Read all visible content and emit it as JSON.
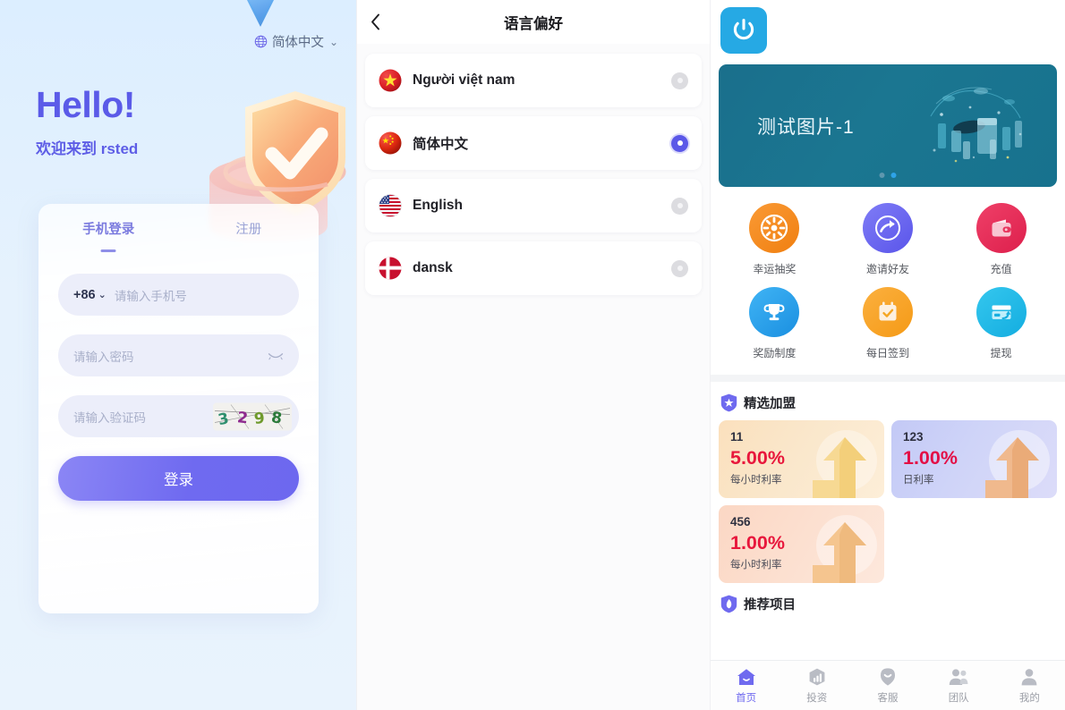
{
  "login": {
    "lang_switcher": {
      "icon": "globe-icon",
      "label": "简体中文",
      "chevron": "⌄"
    },
    "hello": "Hello!",
    "welcome": "欢迎来到 rsted",
    "tabs": [
      {
        "label": "手机登录",
        "active": true
      },
      {
        "label": "注册",
        "active": false
      }
    ],
    "phone_field": {
      "country_code": "+86",
      "chevron": "⌄",
      "placeholder": "请输入手机号",
      "value": ""
    },
    "password_field": {
      "placeholder": "请输入密码",
      "value": "",
      "toggle_icon": "eye-closed-icon"
    },
    "captcha_field": {
      "placeholder": "请输入验证码",
      "value": "",
      "captcha_text": "3298"
    },
    "submit_label": "登录",
    "accent": "#6d68ef",
    "heading_color": "#5b5be8",
    "bg_color": "#e6f2fd"
  },
  "language": {
    "back_icon": "chevron-left-icon",
    "title": "语言偏好",
    "items": [
      {
        "flag": "flag-vietnam",
        "label": "Người việt nam",
        "selected": false
      },
      {
        "flag": "flag-china",
        "label": "简体中文",
        "selected": true
      },
      {
        "flag": "flag-usa",
        "label": "English",
        "selected": false
      },
      {
        "flag": "flag-denmark",
        "label": "dansk",
        "selected": false
      }
    ],
    "selected_color": "#5b58e8"
  },
  "home": {
    "logo_icon": "power-icon",
    "logo_color": "#26a9e4",
    "banner": {
      "title": "测试图片-1",
      "bg_color": "#1b7691",
      "dots_total": 2,
      "dots_active_index": 1
    },
    "quick_actions": [
      {
        "icon": "lottery-wheel-icon",
        "label": "幸运抽奖",
        "color": "#f58220"
      },
      {
        "icon": "share-arrow-icon",
        "label": "邀请好友",
        "color": "#6a6af0"
      },
      {
        "icon": "wallet-icon",
        "label": "充值",
        "color": "#e8345c"
      },
      {
        "icon": "trophy-icon",
        "label": "奖励制度",
        "color": "#2196f3"
      },
      {
        "icon": "calendar-check-icon",
        "label": "每日签到",
        "color": "#f5a623"
      },
      {
        "icon": "withdraw-card-icon",
        "label": "提现",
        "color": "#22b8e8"
      }
    ],
    "featured": {
      "badge_icon": "shield-star-icon",
      "title": "精选加盟",
      "cards": [
        {
          "name": "11",
          "rate": "5.00%",
          "sub": "每小时利率",
          "rate_color": "#e8173c"
        },
        {
          "name": "123",
          "rate": "1.00%",
          "sub": "日利率",
          "rate_color": "#e30f46"
        },
        {
          "name": "456",
          "rate": "1.00%",
          "sub": "每小时利率",
          "rate_color": "#e8173c"
        }
      ]
    },
    "recommended": {
      "badge_icon": "shield-flame-icon",
      "title": "推荐项目"
    },
    "nav": [
      {
        "icon": "home-icon",
        "label": "首页",
        "active": true
      },
      {
        "icon": "investment-icon",
        "label": "投资",
        "active": false
      },
      {
        "icon": "support-icon",
        "label": "客服",
        "active": false
      },
      {
        "icon": "team-icon",
        "label": "团队",
        "active": false
      },
      {
        "icon": "profile-icon",
        "label": "我的",
        "active": false
      }
    ],
    "nav_active_color": "#6f6aef"
  }
}
